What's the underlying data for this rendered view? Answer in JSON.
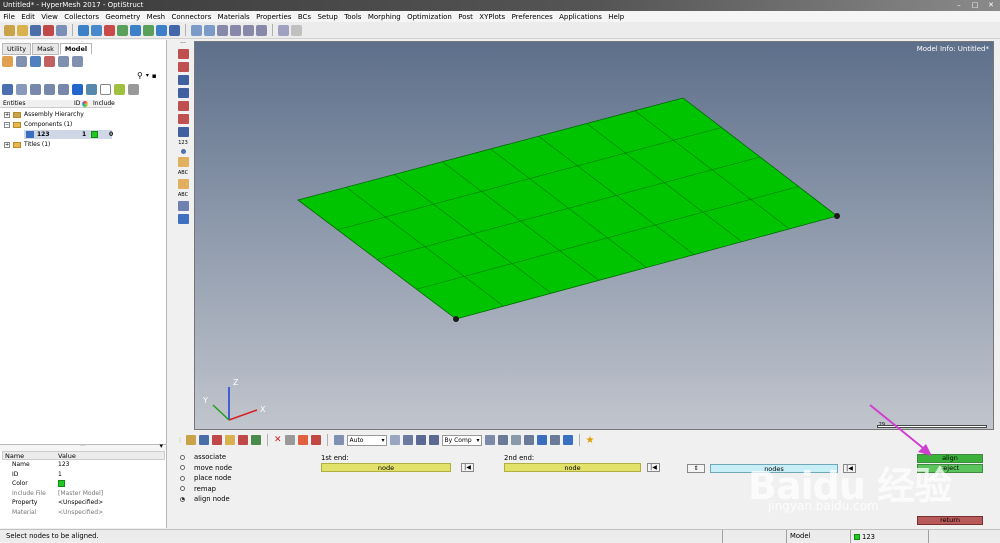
{
  "window": {
    "title": "Untitled* - HyperMesh 2017 - OptiStruct"
  },
  "menu": [
    "File",
    "Edit",
    "View",
    "Collectors",
    "Geometry",
    "Mesh",
    "Connectors",
    "Materials",
    "Properties",
    "BCs",
    "Setup",
    "Tools",
    "Morphing",
    "Optimization",
    "Post",
    "XYPlots",
    "Preferences",
    "Applications",
    "Help"
  ],
  "left_panel": {
    "tabs": [
      "Utility",
      "Mask",
      "Model"
    ],
    "active_tab": "Model",
    "columns": {
      "entities": "Entities",
      "id": "ID",
      "include": "Include"
    },
    "tree": [
      {
        "label": "Assembly Hierarchy"
      },
      {
        "label": "Components (1)"
      },
      {
        "label": "123",
        "id": "1",
        "include": "0",
        "color": "#22c922"
      },
      {
        "label": "Titles (1)"
      }
    ],
    "properties": {
      "header_name": "Name",
      "header_value": "Value",
      "rows": [
        {
          "k": "Name",
          "v": "123"
        },
        {
          "k": "ID",
          "v": "1"
        },
        {
          "k": "Color",
          "v": ""
        },
        {
          "k": "Include File",
          "v": "[Master Model]"
        },
        {
          "k": "Property",
          "v": "<Unspecified>"
        },
        {
          "k": "Material",
          "v": "<Unspecified>"
        }
      ]
    }
  },
  "viewport": {
    "model_info": "Model Info: Untitled*",
    "scale_label": "29",
    "mesh_color": "#00cc00",
    "axes": {
      "x": "X",
      "y": "Y",
      "z": "Z"
    }
  },
  "bottom_toolbar": {
    "auto_label": "Auto",
    "bycomp_label": "By Comp"
  },
  "panel": {
    "options": [
      {
        "label": "associate",
        "checked": false
      },
      {
        "label": "move node",
        "checked": false
      },
      {
        "label": "place node",
        "checked": false
      },
      {
        "label": "remap",
        "checked": false
      },
      {
        "label": "align node",
        "checked": true
      }
    ],
    "first_end_label": "1st end:",
    "first_end_value": "node",
    "second_end_label": "2nd end:",
    "second_end_value": "node",
    "nodes_label": "nodes",
    "align_label": "align",
    "reject_label": "reject",
    "return_label": "return"
  },
  "status": {
    "message": "Select nodes to be aligned.",
    "mode": "Model",
    "component": "123"
  },
  "watermark": {
    "brand": "Baidu 经验",
    "url": "jingyan.baidu.com"
  }
}
